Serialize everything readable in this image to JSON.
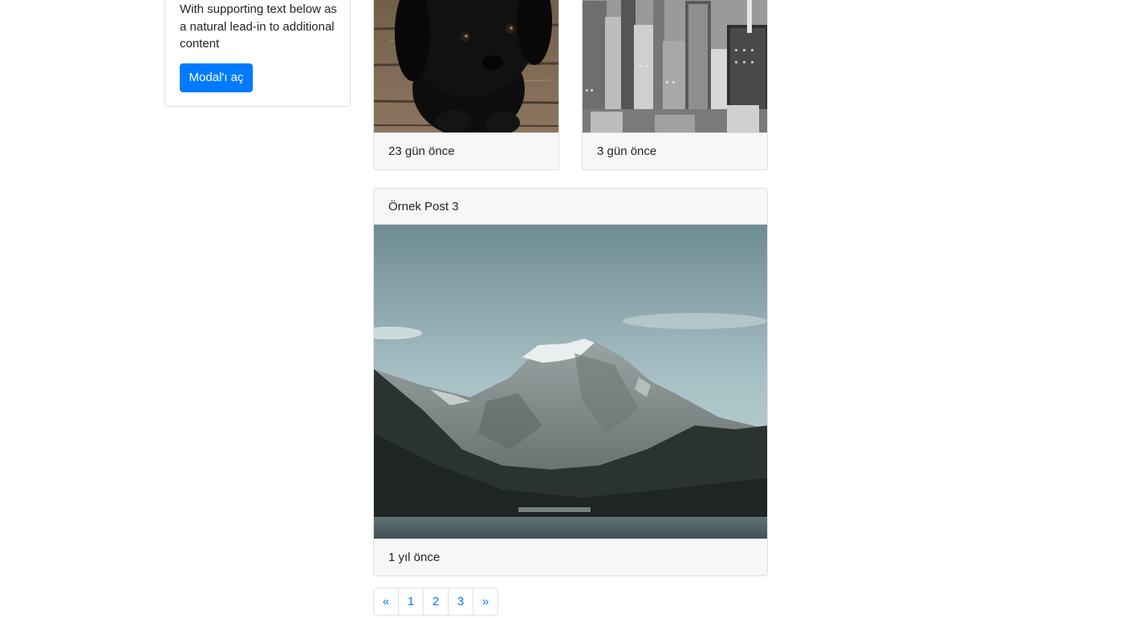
{
  "sidebar_card": {
    "text": "With supporting text below as a natural lead-in to additional content",
    "button_label": "Modal'ı aç"
  },
  "posts": [
    {
      "image_subject": "black puppy on wooden floor",
      "footer": "23 gün önce"
    },
    {
      "image_subject": "black and white city skyline",
      "footer": "3 gün önce"
    },
    {
      "title": "Örnek Post 3",
      "image_subject": "snowy mountain above lake",
      "footer": "1 yıl önce"
    }
  ],
  "pagination": {
    "prev": "«",
    "pages": [
      "1",
      "2",
      "3"
    ],
    "next": "»"
  },
  "colors": {
    "primary": "#007bff",
    "card_header_bg": "#f7f7f7",
    "border": "#dfdfdf"
  }
}
